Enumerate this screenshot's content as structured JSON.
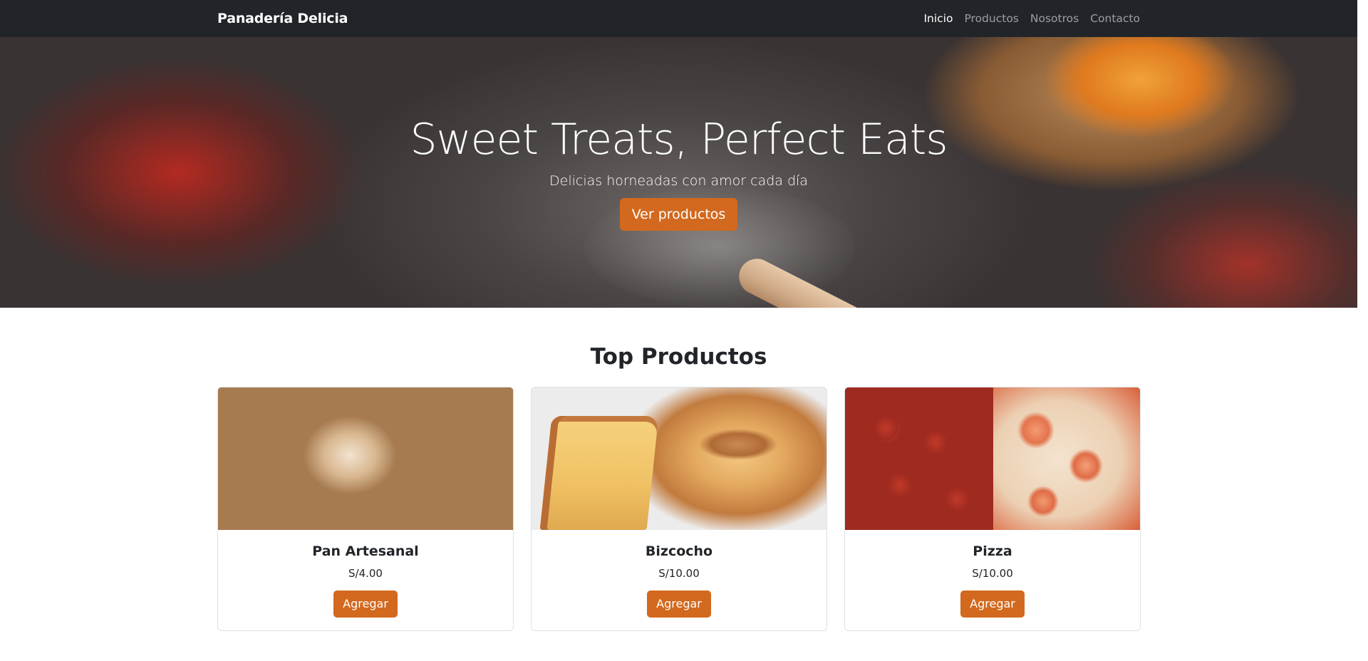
{
  "navbar": {
    "brand": "Panadería Delicia",
    "links": [
      {
        "label": "Inicio",
        "active": true
      },
      {
        "label": "Productos",
        "active": false
      },
      {
        "label": "Nosotros",
        "active": false
      },
      {
        "label": "Contacto",
        "active": false
      }
    ]
  },
  "hero": {
    "title": "Sweet Treats, Perfect Eats",
    "subtitle": "Delicias horneadas con amor cada día",
    "button_label": "Ver productos"
  },
  "section": {
    "title": "Top Productos"
  },
  "products": [
    {
      "name": "Pan Artesanal",
      "price": "S/4.00",
      "button_label": "Agregar",
      "image": "bread-rolls-image"
    },
    {
      "name": "Bizcocho",
      "price": "S/10.00",
      "button_label": "Agregar",
      "image": "sponge-cake-image"
    },
    {
      "name": "Pizza",
      "price": "S/10.00",
      "button_label": "Agregar",
      "image": "pizza-image"
    }
  ],
  "colors": {
    "navbar_bg": "#212529",
    "accent": "#d2691e",
    "card_border": "#dee2e6"
  }
}
